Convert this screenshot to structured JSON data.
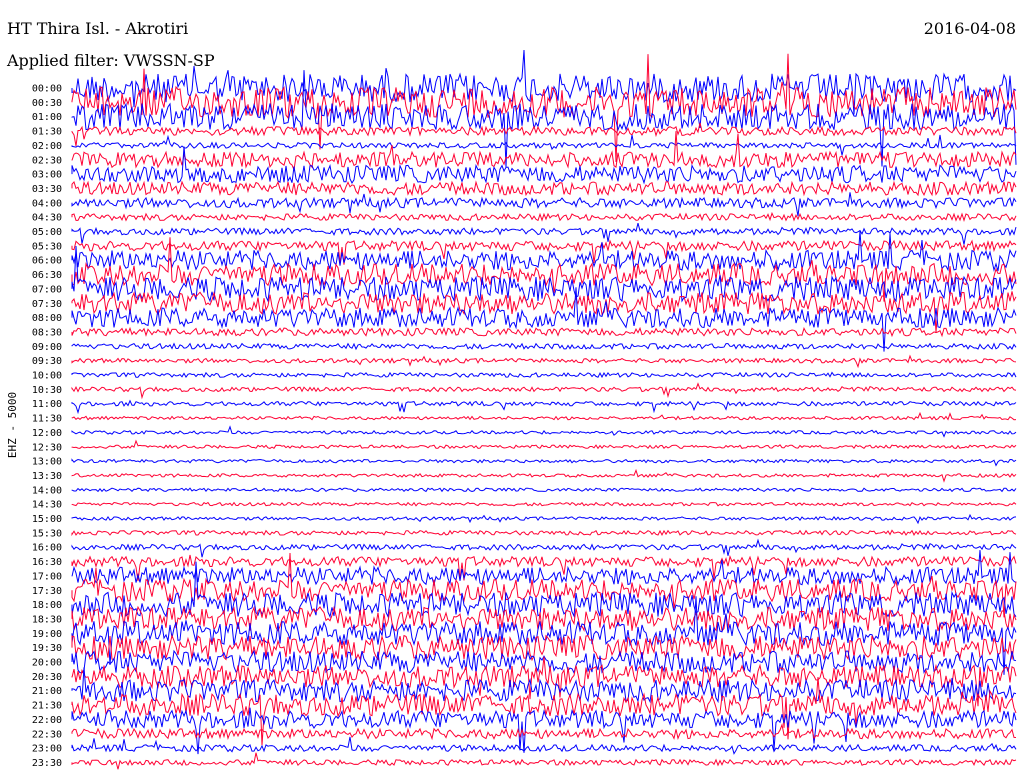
{
  "header": {
    "station": "HT Thira Isl. - Akrotiri",
    "filter": "Applied filter: VWSSN-SP",
    "date": "2016-04-08"
  },
  "side_label": "EHZ - 5000",
  "colors": {
    "trace_even": "#0000ff",
    "trace_odd": "#ff0033",
    "text": "#000000",
    "background": "#ffffff"
  },
  "chart_data": {
    "type": "line",
    "title": "",
    "xlabel": "",
    "ylabel": "EHZ - 5000",
    "row_labels": [
      "00:00",
      "00:30",
      "01:00",
      "01:30",
      "02:00",
      "02:30",
      "03:00",
      "03:30",
      "04:00",
      "04:30",
      "05:00",
      "05:30",
      "06:00",
      "06:30",
      "07:00",
      "07:30",
      "08:00",
      "08:30",
      "09:00",
      "09:30",
      "10:00",
      "10:30",
      "11:00",
      "11:30",
      "12:00",
      "12:30",
      "13:00",
      "13:30",
      "14:00",
      "14:30",
      "15:00",
      "15:30",
      "16:00",
      "16:30",
      "17:00",
      "17:30",
      "18:00",
      "18:30",
      "19:00",
      "19:30",
      "20:00",
      "20:30",
      "21:00",
      "21:30",
      "22:00",
      "22:30",
      "23:00",
      "23:30"
    ],
    "row_minutes": 30,
    "row_activity": [
      2.6,
      2.8,
      2.4,
      0.8,
      0.5,
      1.4,
      1.6,
      1.2,
      0.9,
      0.6,
      0.6,
      0.9,
      1.8,
      2.0,
      2.2,
      2.0,
      1.8,
      0.7,
      0.5,
      0.4,
      0.4,
      0.4,
      0.4,
      0.3,
      0.3,
      0.3,
      0.3,
      0.3,
      0.3,
      0.3,
      0.3,
      0.4,
      0.5,
      0.9,
      1.6,
      2.0,
      2.2,
      2.2,
      2.2,
      2.2,
      2.0,
      2.0,
      2.0,
      2.0,
      1.6,
      0.9,
      0.6,
      0.5
    ],
    "grid": false,
    "legend": "none"
  }
}
